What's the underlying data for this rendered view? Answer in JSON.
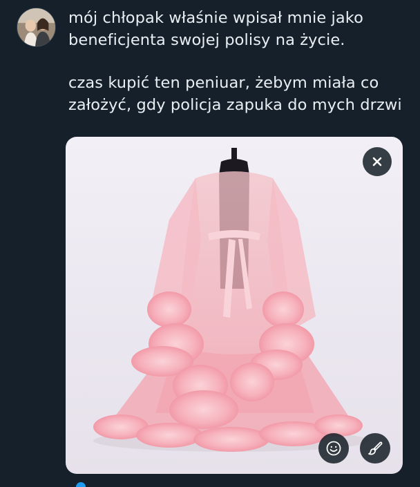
{
  "tweet": {
    "line1": "mój chłopak właśnie wpisał mnie jako",
    "line2": "beneficjenta swojej polisy na życie.",
    "line3": "czas kupić ten peniuar, żebym miała co",
    "line4": "założyć, gdy policja zapuka do mych drzwi"
  },
  "media": {
    "close_icon": "close-icon",
    "sticker_icon": "smiley-icon",
    "edit_icon": "brush-icon"
  },
  "colors": {
    "background": "#15202b",
    "text": "#e9eef2",
    "accent": "#1d9bf0",
    "robe": "#f3a9b3"
  }
}
